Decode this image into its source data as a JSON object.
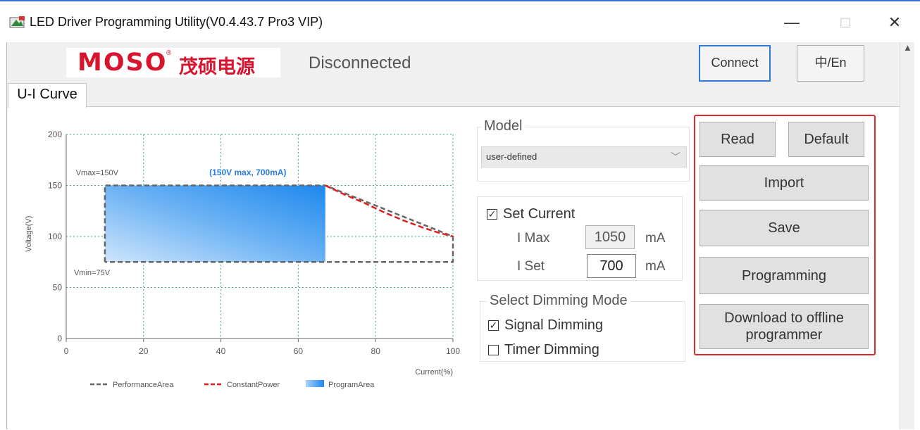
{
  "window": {
    "title": "LED Driver Programming Utility(V0.4.43.7 Pro3 VIP)",
    "minimize_glyph": "—",
    "maximize_glyph": "□",
    "close_glyph": "✕"
  },
  "header": {
    "logo_brand": "MOSO",
    "logo_registered": "®",
    "logo_chinese": "茂硕电源",
    "status": "Disconnected",
    "connect_label": "Connect",
    "lang_label": "中/En"
  },
  "tabs": [
    {
      "label": "U-I Curve"
    }
  ],
  "chart_data": {
    "type": "area",
    "xlabel": "Current(%)",
    "ylabel": "Voltage(V)",
    "xlim": [
      0,
      100
    ],
    "ylim": [
      0,
      200
    ],
    "x_ticks": [
      "0",
      "20",
      "40",
      "60",
      "80",
      "100"
    ],
    "y_ticks": [
      "0",
      "50",
      "100",
      "150",
      "200"
    ],
    "grid": true,
    "annotations": {
      "vmax": "Vmax=150V",
      "vmin": "Vmin=75V",
      "point": "(150V max, 700mA)"
    },
    "series": [
      {
        "name": "PerformanceArea",
        "style": "dashed",
        "color": "#555555",
        "points": [
          [
            10,
            75
          ],
          [
            10,
            150
          ],
          [
            67,
            150
          ],
          [
            100,
            100
          ],
          [
            100,
            75
          ],
          [
            10,
            75
          ]
        ]
      },
      {
        "name": "ConstantPower",
        "style": "dashed",
        "color": "#e02020",
        "points": [
          [
            67,
            150
          ],
          [
            72,
            141
          ],
          [
            77,
            133
          ],
          [
            82,
            124
          ],
          [
            87,
            116
          ],
          [
            92,
            109
          ],
          [
            96,
            104
          ],
          [
            100,
            100
          ]
        ]
      },
      {
        "name": "ProgramArea",
        "style": "fill",
        "color": "#3a96f2",
        "x_range": [
          10,
          67
        ],
        "y_range": [
          75,
          150
        ]
      }
    ],
    "legend": [
      "PerformanceArea",
      "ConstantPower",
      "ProgramArea"
    ],
    "legend_position": "bottom"
  },
  "model": {
    "group_label": "Model",
    "selected": "user-defined"
  },
  "current": {
    "set_current_label": "Set Current",
    "set_current_checked": true,
    "imax_label": "I Max",
    "imax_value": "1050",
    "iset_label": "I Set",
    "iset_value": "700",
    "unit": "mA"
  },
  "dimming": {
    "group_label": "Select Dimming Mode",
    "signal_label": "Signal Dimming",
    "signal_checked": true,
    "timer_label": "Timer Dimming",
    "timer_checked": false
  },
  "actions": {
    "read": "Read",
    "default": "Default",
    "import": "Import",
    "save": "Save",
    "programming": "Programming",
    "download": "Download to offline programmer"
  }
}
